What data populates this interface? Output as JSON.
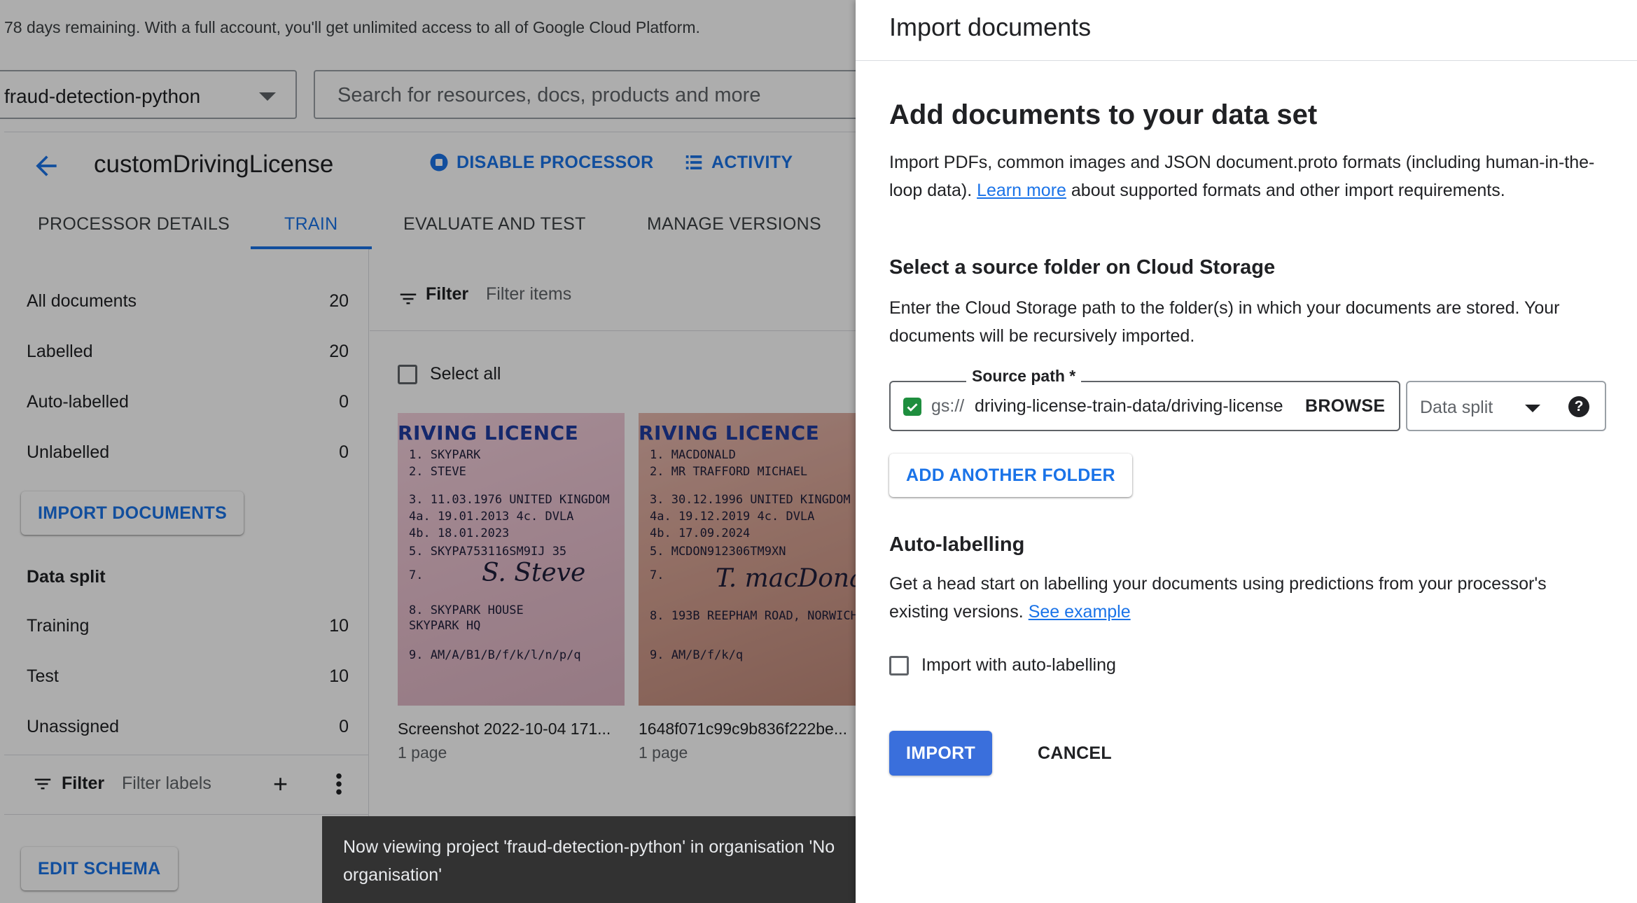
{
  "banner": {
    "text": "78 days remaining. With a full account, you'll get unlimited access to all of Google Cloud Platform."
  },
  "topbar": {
    "project": "fraud-detection-python",
    "search_placeholder": "Search for resources, docs, products and more"
  },
  "processor": {
    "name": "customDrivingLicense",
    "disable_label": "DISABLE PROCESSOR",
    "activity_label": "ACTIVITY"
  },
  "tabs": [
    {
      "label": "PROCESSOR DETAILS"
    },
    {
      "label": "TRAIN"
    },
    {
      "label": "EVALUATE AND TEST"
    },
    {
      "label": "MANAGE VERSIONS"
    }
  ],
  "active_tab": "TRAIN",
  "sidebar": {
    "counts": [
      {
        "label": "All documents",
        "value": "20"
      },
      {
        "label": "Labelled",
        "value": "20"
      },
      {
        "label": "Auto-labelled",
        "value": "0"
      },
      {
        "label": "Unlabelled",
        "value": "0"
      }
    ],
    "import_button": "IMPORT DOCUMENTS",
    "data_split_title": "Data split",
    "split": [
      {
        "label": "Training",
        "value": "10"
      },
      {
        "label": "Test",
        "value": "10"
      },
      {
        "label": "Unassigned",
        "value": "0"
      }
    ],
    "filter_label": "Filter",
    "filter_placeholder": "Filter labels",
    "edit_schema": "EDIT SCHEMA"
  },
  "documents": {
    "filter_label": "Filter",
    "filter_placeholder": "Filter items",
    "select_all": "Select all",
    "items": [
      {
        "name": "Screenshot 2022-10-04 171...",
        "pages": "1 page",
        "header": "RIVING LICENCE",
        "lines": [
          "1.  SKYPARK",
          "2.  STEVE",
          "3.  11.03.1976 UNITED KINGDOM",
          "4a. 19.01.2013  4c. DVLA",
          "4b. 18.01.2023",
          "5.     SKYPA753116SM9IJ 35",
          "7.",
          "8.  SKYPARK HOUSE",
          "    SKYPARK HQ",
          "9.  AM/A/B1/B/f/k/l/n/p/q"
        ],
        "signature": "S. Steve"
      },
      {
        "name": "1648f071c99c9b836f222be...",
        "pages": "1 page",
        "header": "RIVING LICENCE",
        "lines": [
          "1.  MACDONALD",
          "2.  MR TRAFFORD MICHAEL",
          "3.  30.12.1996 UNITED KINGDOM",
          "4a. 19.12.2019  4c. DVLA",
          "4b. 17.09.2024",
          "5.     MCDON912306TM9XN",
          "7.",
          "8.  193B REEPHAM ROAD, NORWICH",
          "",
          "9.  AM/B/f/k/q"
        ],
        "signature": "T. macDonald"
      }
    ]
  },
  "snackbar": {
    "text": "Now viewing project 'fraud-detection-python' in organisation 'No organisation'"
  },
  "panel": {
    "title": "Import documents",
    "heading": "Add documents to your data set",
    "intro_text": "Import PDFs, common images and JSON document.proto formats (including human-in-the-loop data).",
    "intro_link": "Learn more",
    "intro_tail": "about supported formats and other import requirements.",
    "source_title": "Select a source folder on Cloud Storage",
    "source_desc": "Enter the Cloud Storage path to the folder(s) in which your documents are stored. Your documents will be recursively imported.",
    "source_label": "Source path *",
    "source_prefix": "gs://",
    "source_value": "driving-license-train-data/driving-license",
    "browse": "BROWSE",
    "split_placeholder": "Data split",
    "help_icon": "?",
    "add_folder": "ADD ANOTHER FOLDER",
    "auto_title": "Auto-labelling",
    "auto_desc": "Get a head start on labelling your documents using predictions from your processor's existing versions.",
    "auto_link": "See example",
    "auto_checkbox": "Import with auto-labelling",
    "import": "IMPORT",
    "cancel": "CANCEL"
  },
  "colors": {
    "accent": "#1a73e8",
    "primary_button": "#3a6fdc",
    "snackbar": "#323232"
  }
}
